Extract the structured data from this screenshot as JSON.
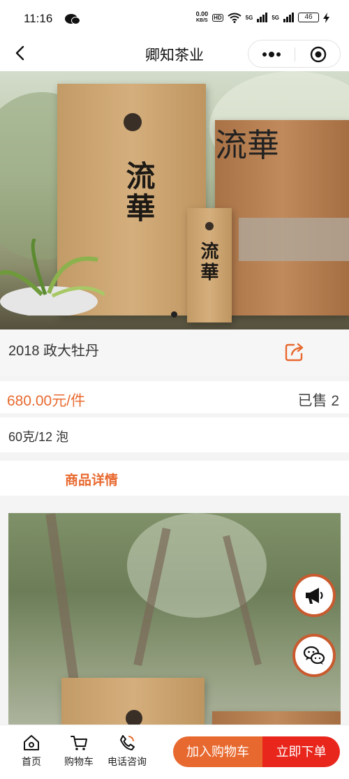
{
  "status_bar": {
    "time": "11:16",
    "speed_value": "0.00",
    "speed_unit": "KB/S",
    "hd": "HD",
    "net1": "5G",
    "net2": "5G",
    "battery": "46"
  },
  "nav": {
    "title": "卿知茶业"
  },
  "hero": {
    "calligraphy": "流華",
    "image_count": 1,
    "active_index": 0
  },
  "product": {
    "name": "2018 政大牡丹",
    "price": "680.00元/件",
    "sold": "已售 2",
    "spec": "60克/12 泡"
  },
  "tabs": {
    "detail": "商品详情"
  },
  "floating": {
    "announce_icon": "megaphone-icon",
    "chat_icon": "chat-bubbles-icon"
  },
  "bottom_bar": {
    "home": "首页",
    "cart": "购物车",
    "phone": "电话咨询",
    "add_to_cart": "加入购物车",
    "buy_now": "立即下单"
  },
  "colors": {
    "accent": "#e8692f",
    "buy": "#e8261c"
  }
}
